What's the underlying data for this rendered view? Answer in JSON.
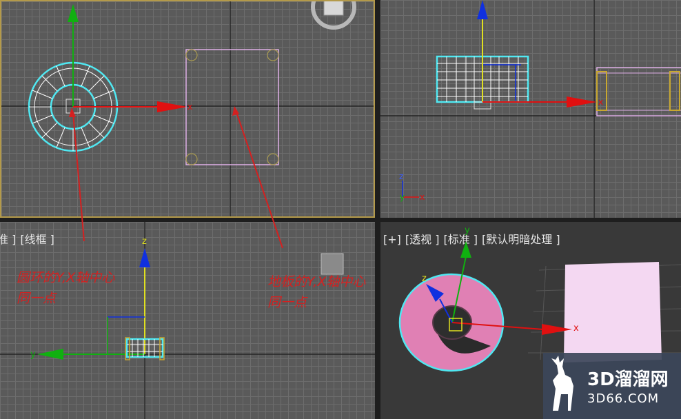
{
  "viewports": {
    "front": {
      "label_parts": [
        "准 ]",
        "[线框 ]"
      ]
    },
    "perspective": {
      "label_parts": [
        "[+]",
        "[透视 ]",
        "[标准 ]",
        "[默认明暗处理 ]"
      ]
    }
  },
  "axes": {
    "x": "x",
    "y": "y",
    "z": "z"
  },
  "annotations": {
    "ring": [
      "圆环的Y,X轴中心",
      "同一点"
    ],
    "plane": [
      "地板的Y,X轴中心",
      "同一点"
    ]
  },
  "watermark": {
    "brand": "3D溜溜网",
    "url": "3D66.COM"
  },
  "colors": {
    "selection": "#4fe8f2",
    "x_axis": "#e01010",
    "y_axis": "#10b010",
    "z_axis": "#1030e0",
    "annotation": "#d42020",
    "active_border": "#b49a4a",
    "torus_fill": "#e080b4",
    "plane_fill": "#f4d8f2"
  }
}
